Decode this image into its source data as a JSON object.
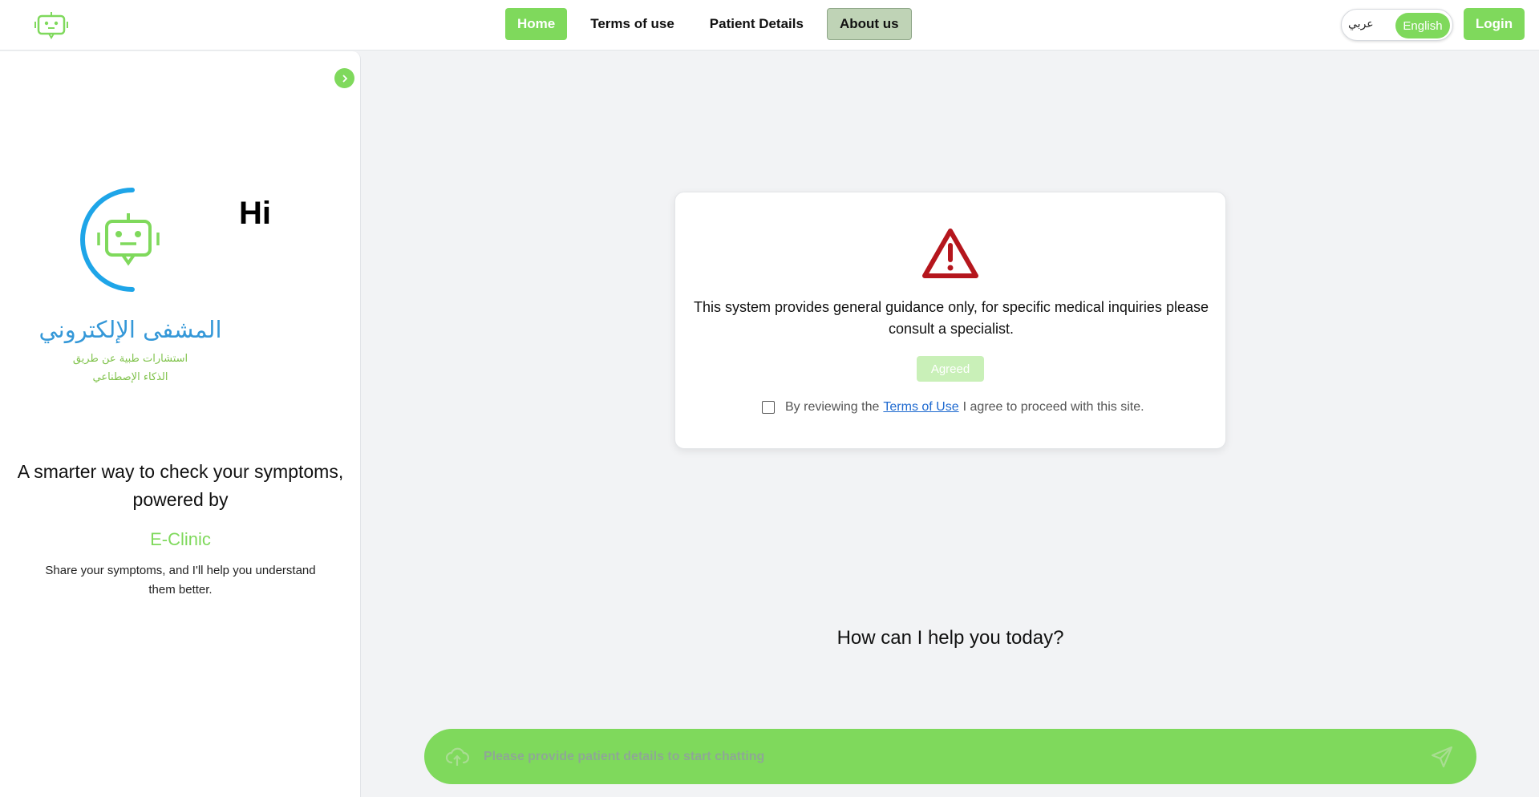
{
  "header": {
    "logo": "robot-chat-logo",
    "nav": [
      {
        "label": "Home",
        "active": true
      },
      {
        "label": "Terms of use",
        "active": false
      },
      {
        "label": "Patient Details",
        "active": false
      },
      {
        "label": "About us",
        "active": false
      }
    ],
    "language": {
      "arabic": "عربي",
      "english": "English",
      "selected": "English"
    },
    "login_label": "Login"
  },
  "sidebar": {
    "greeting": "Hi",
    "arabic_title": "المشفى الإلكتروني",
    "arabic_subtitle_line1": "استشارات طبية عن طريق",
    "arabic_subtitle_line2": "الذكاء الإصطناعي",
    "tagline": "A smarter way to check your symptoms, powered by",
    "brand": "E-Clinic",
    "description": "Share your symptoms, and I'll help you understand them better."
  },
  "terms_card": {
    "message": "This system provides general guidance only, for specific medical inquiries please consult a specialist.",
    "agree_button": "Agreed",
    "agree_prefix": "By reviewing the",
    "terms_link": "Terms of Use",
    "agree_suffix": "I agree to proceed with this site."
  },
  "main": {
    "help_prompt": "How can I help you today?",
    "chat_placeholder": "Please provide patient details to start chatting"
  },
  "colors": {
    "accent": "#7fd95c",
    "brand_blue": "#3598d8",
    "warning": "#b5161d"
  }
}
